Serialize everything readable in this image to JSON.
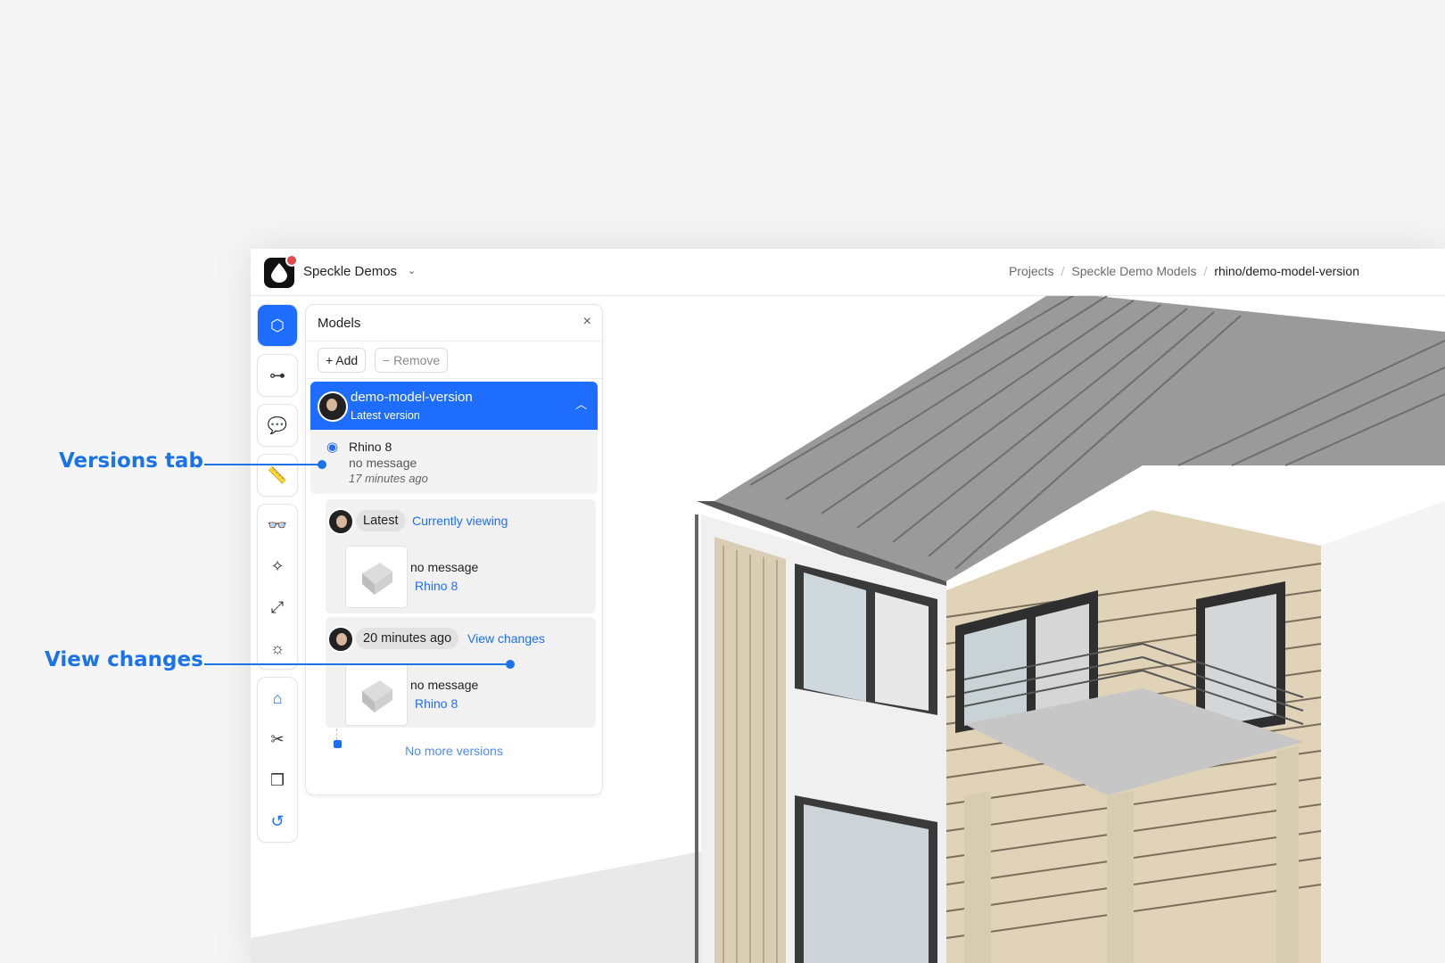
{
  "workspace": {
    "name": "Speckle Demos"
  },
  "breadcrumb": [
    "Projects",
    "Speckle Demo Models",
    "rhino/demo-model-version"
  ],
  "panel": {
    "title": "Models",
    "add_label": "+ Add",
    "remove_label": "− Remove",
    "model": {
      "name": "demo-model-version",
      "subtitle": "Latest version",
      "source": "Rhino 8",
      "message": "no message",
      "time": "17 minutes ago"
    },
    "versions": [
      {
        "pill": "Latest",
        "link": "Currently viewing",
        "message": "no message",
        "source": "Rhino 8"
      },
      {
        "pill": "20 minutes ago",
        "link": "View changes",
        "message": "no message",
        "source": "Rhino 8"
      }
    ],
    "no_more": "No more versions"
  },
  "toolbar": {
    "icons": [
      "cube-icon",
      "scene-tree-icon",
      "comments-icon",
      "measure-icon",
      "glasses-icon",
      "explode-icon",
      "zoom-extents-icon",
      "sun-icon",
      "section-box-icon",
      "scissors-icon",
      "cubes-icon",
      "undo-icon"
    ]
  },
  "callouts": {
    "versions_tab": "Versions tab",
    "view_changes": "View changes"
  },
  "colors": {
    "accent": "#1f6dff",
    "callout": "#1a73e8"
  }
}
